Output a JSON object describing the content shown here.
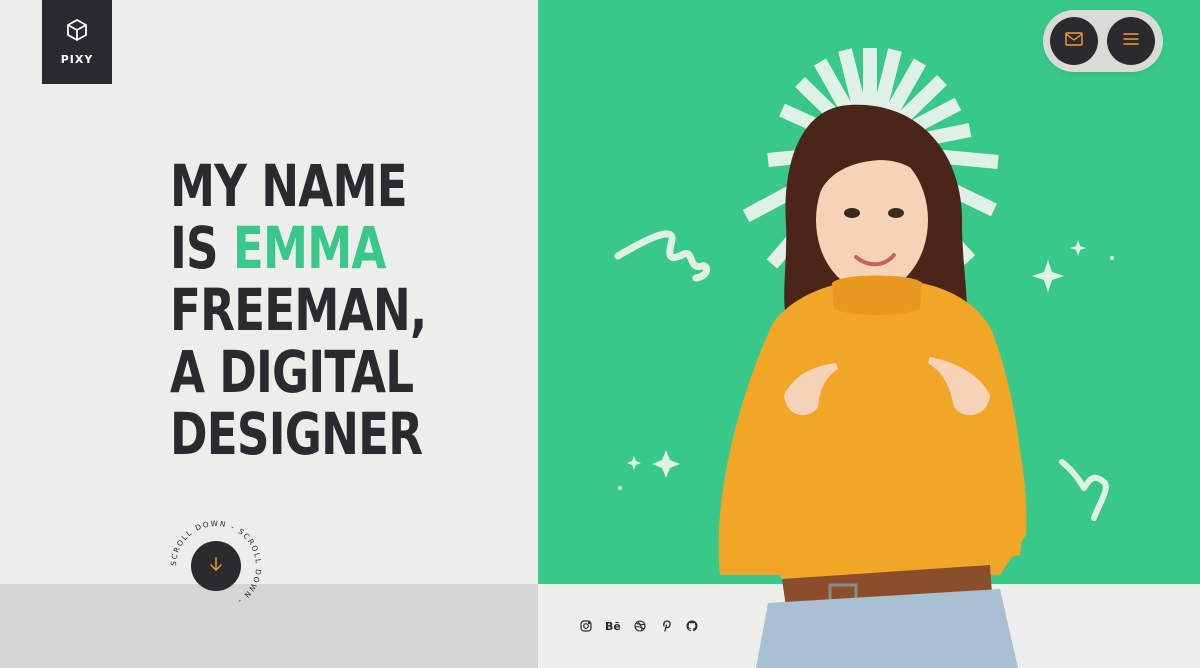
{
  "brand": {
    "logo_text": "PIXY",
    "icon": "cube-icon"
  },
  "hero": {
    "line1": "MY NAME",
    "line2_prefix": "IS ",
    "line2_accent": "EMMA",
    "line3": "FREEMAN,",
    "line4": "A DIGITAL",
    "line5": "DESIGNER"
  },
  "scroll": {
    "ring_text": "SCROLL DOWN - SCROLL DOWN - ",
    "icon": "arrow-down-icon"
  },
  "header_actions": {
    "mail_icon": "mail-icon",
    "menu_icon": "hamburger-menu-icon"
  },
  "social": {
    "behance_label": "Bē",
    "icons": [
      "instagram-icon",
      "behance-icon",
      "dribbble-icon",
      "pinterest-icon",
      "github-icon"
    ]
  },
  "colors": {
    "accent": "#38c98a",
    "dark": "#2b2b2f",
    "light_bg": "#ededeb",
    "icon_orange": "#f0a030",
    "sweater": "#f1a628"
  }
}
